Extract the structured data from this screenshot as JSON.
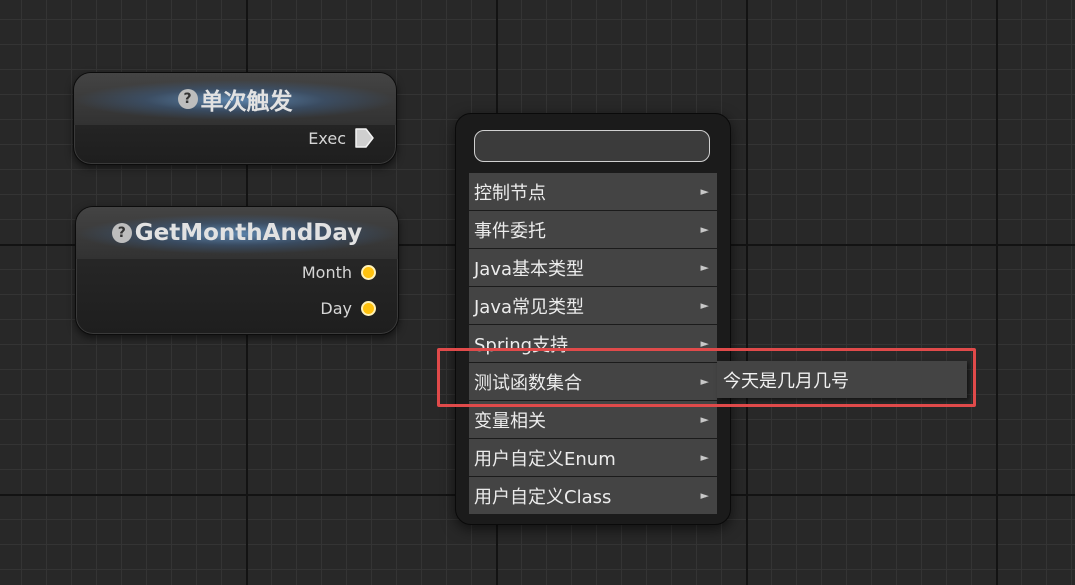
{
  "nodes": {
    "trigger": {
      "title": "单次触发",
      "help_icon": "?",
      "output_label": "Exec",
      "output_icon": "exec-pin-icon"
    },
    "get_month_day": {
      "title": "GetMonthAndDay",
      "help_icon": "?",
      "outputs": [
        {
          "label": "Month",
          "color": "#ffc20e"
        },
        {
          "label": "Day",
          "color": "#ffc20e"
        }
      ]
    }
  },
  "context_menu": {
    "search_value": "",
    "items": [
      {
        "label": "控制节点",
        "arrow": "►"
      },
      {
        "label": "事件委托",
        "arrow": "►"
      },
      {
        "label": "Java基本类型",
        "arrow": "►"
      },
      {
        "label": "Java常见类型",
        "arrow": "►"
      },
      {
        "label": "Spring支持",
        "arrow": "►"
      },
      {
        "label": "测试函数集合",
        "arrow": "►"
      },
      {
        "label": "变量相关",
        "arrow": "►"
      },
      {
        "label": "用户自定义Enum",
        "arrow": "►"
      },
      {
        "label": "用户自定义Class",
        "arrow": "►"
      }
    ],
    "submenu": {
      "items": [
        {
          "label": "今天是几月几号"
        }
      ]
    }
  },
  "colors": {
    "highlight": "#e04a4a",
    "data_pin": "#ffc20e",
    "header_glow": "#69a0d7"
  }
}
